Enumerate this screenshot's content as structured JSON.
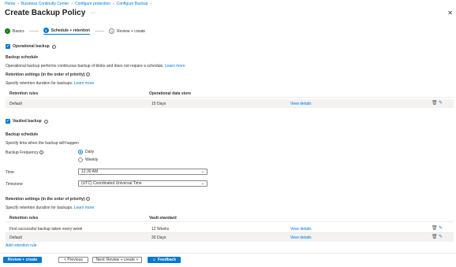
{
  "breadcrumb": [
    "Home",
    "Business Continuity Center",
    "Configure protection",
    "Configure Backup"
  ],
  "page": {
    "title": "Create Backup Policy",
    "more": "···",
    "close": "✕"
  },
  "steps": [
    {
      "label": "Basics",
      "status": "done",
      "icon": "✓"
    },
    {
      "label": "Schedule + retention",
      "status": "active",
      "icon": "2"
    },
    {
      "label": "Review + create",
      "status": "todo",
      "icon": "3"
    }
  ],
  "operational": {
    "title": "Operational backup",
    "checked": true,
    "schedule_heading": "Backup schedule",
    "schedule_text": "Operational backup performs continuous backup of blobs and does not require a schedule.",
    "learn_more": "Learn more",
    "retention_heading": "Retention settings (in the order of priority)",
    "retention_text": "Specify retention duration for backups.",
    "retention_learn_more": "Learn more",
    "table": {
      "headers": [
        "Retention rules",
        "Operational data store"
      ],
      "rows": [
        {
          "rule": "Default",
          "value": "15 Days",
          "action": "View details"
        }
      ]
    }
  },
  "vaulted": {
    "title": "Vaulted backup",
    "checked": true,
    "schedule_heading": "Backup schedule",
    "schedule_text": "Specify time when the backup will happen",
    "frequency_label": "Backup Frequency",
    "frequency_options": [
      "Daily",
      "Weekly"
    ],
    "frequency_selected": "Daily",
    "time_label": "Time",
    "time_value": "12:30 AM",
    "timezone_label": "Timezone",
    "timezone_value": "(UTC) Coordinated Universal Time",
    "retention_heading": "Retention settings (in the order of priority)",
    "retention_text": "Specify retention duration for backups.",
    "retention_learn_more": "Learn more",
    "table": {
      "headers": [
        "Retention rules",
        "Vault-standard"
      ],
      "rows": [
        {
          "rule": "First successful backup taken every week",
          "value": "12 Weeks",
          "action": "View details"
        },
        {
          "rule": "Default",
          "value": "30 Days",
          "action": "View details"
        }
      ]
    },
    "add_rule": "Add retention rule"
  },
  "footer": {
    "review_create": "Review + create",
    "previous": "< Previous",
    "next": "Next: Review + create >",
    "feedback": "Feedback"
  },
  "colors": {
    "accent": "#0078d4",
    "success": "#107c10",
    "row_bg": "#f3f2f1"
  }
}
